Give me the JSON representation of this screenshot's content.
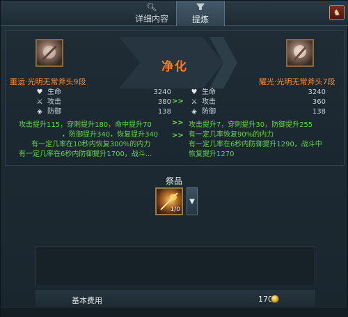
{
  "tabs": {
    "detail": {
      "label": "详细内容",
      "icon": "search-icon"
    },
    "refine": {
      "label": "提炼",
      "icon": "refine-icon"
    }
  },
  "header": {
    "corner_icon": "character-icon"
  },
  "purify": {
    "title": "净化"
  },
  "left_item": {
    "name": "噩运·光明无常斧头9段",
    "stats": [
      {
        "icon": "heart-icon",
        "label": "生命",
        "value": "3240"
      },
      {
        "icon": "swords-icon",
        "label": "攻击",
        "value": "380"
      },
      {
        "icon": "shield-icon",
        "label": "防御",
        "value": "138"
      }
    ],
    "effects": [
      "攻击提升115，穿刺提升180，命中提升70",
      "，防御提升340，恢复提升340",
      "有一定几率在10秒内恢复300%的内力",
      "有一定几率在6秒内防御提升1700，战斗..."
    ]
  },
  "right_item": {
    "name": "耀光·光明无常斧头7段",
    "stats": [
      {
        "icon": "heart-icon",
        "label": "生命",
        "value": "3240"
      },
      {
        "icon": "swords-icon",
        "label": "攻击",
        "value": "360"
      },
      {
        "icon": "shield-icon",
        "label": "防御",
        "value": "138"
      }
    ],
    "effects": [
      "攻击提升7，穿刺提升30，防御提升255",
      "有一定几率恢复90%的内力",
      "有一定几率在6秒内防御提升1290，战斗中",
      "恢复提升1270"
    ]
  },
  "arrows": ">>",
  "material": {
    "label": "祭品",
    "count": "1/0"
  },
  "cost": {
    "label": "基本费用",
    "value": "170"
  },
  "colors": {
    "item_name": "#ff8a2a",
    "effect_text": "#63d64a",
    "title": "#ff7a1a"
  }
}
